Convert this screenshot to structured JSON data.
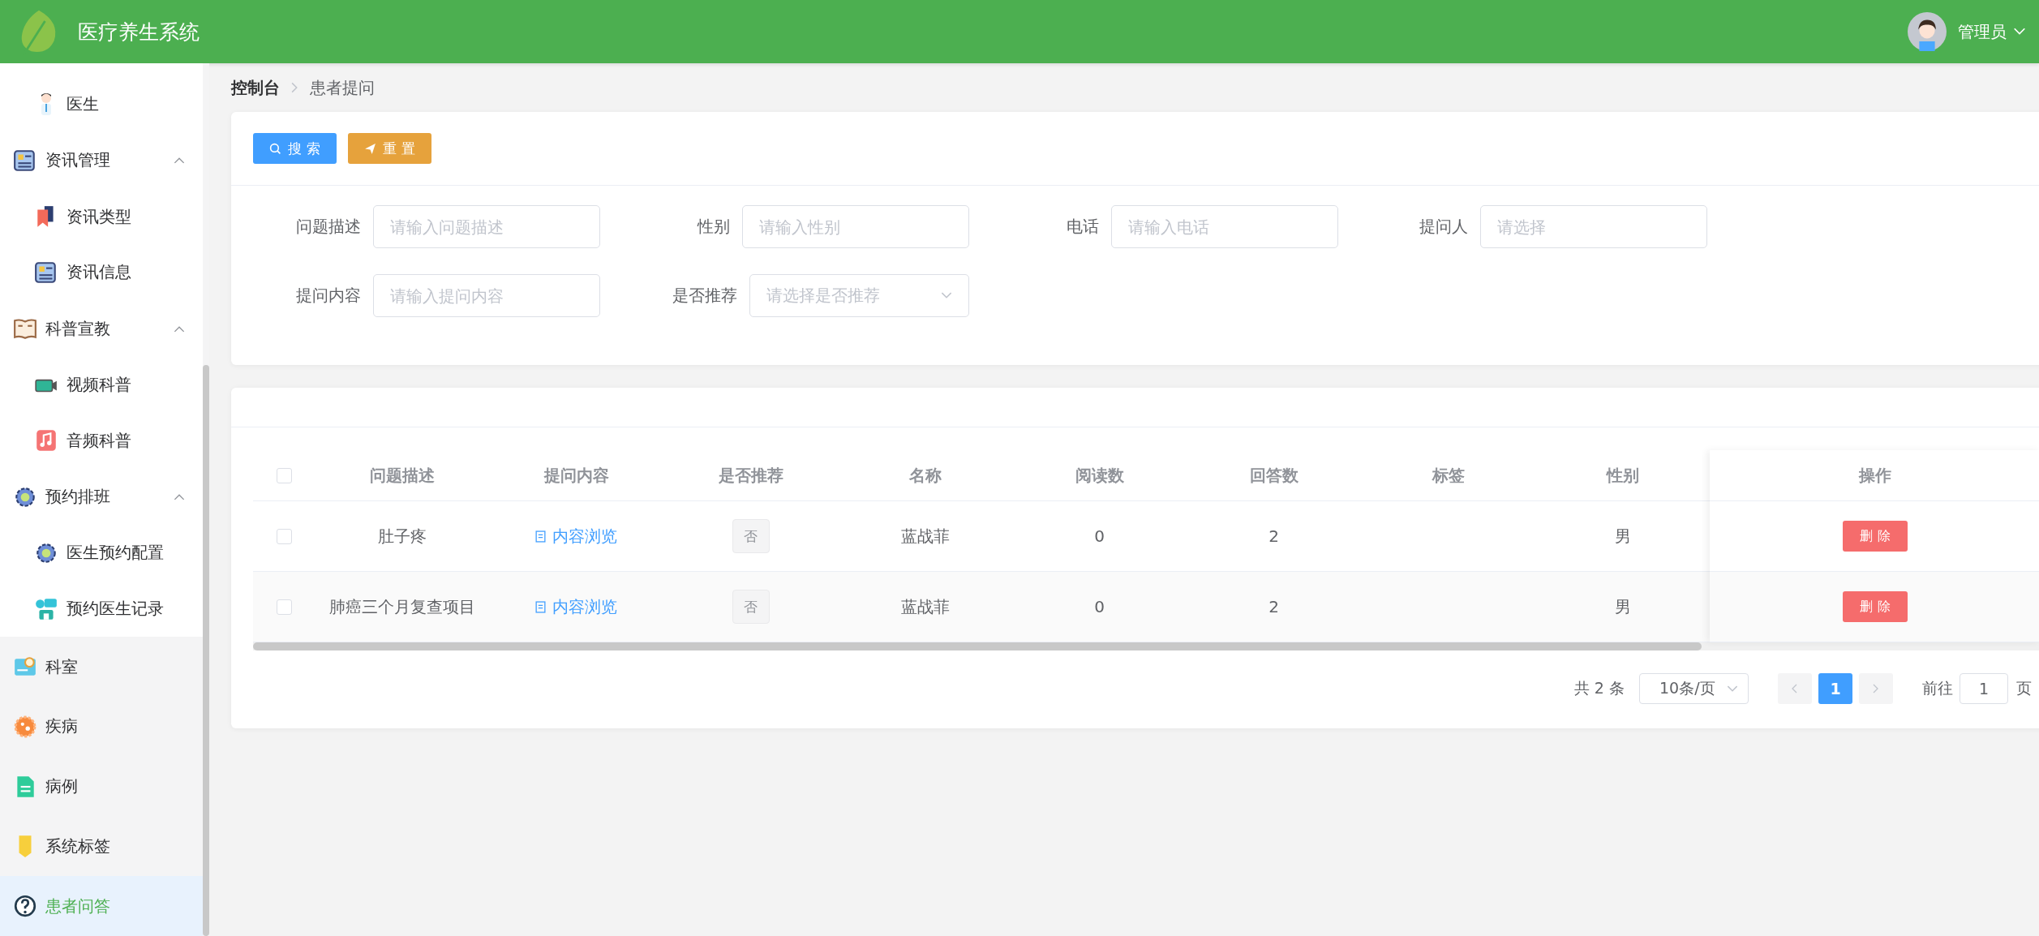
{
  "header": {
    "title": "医疗养生系统",
    "user": "管理员"
  },
  "sidebar": {
    "continued_children": [
      {
        "label": "医生",
        "selected": false
      }
    ],
    "items": [
      {
        "label": "资讯管理",
        "expanded": true,
        "selected": false,
        "children": [
          {
            "label": "资讯类型",
            "selected": false
          },
          {
            "label": "资讯信息",
            "selected": false
          }
        ]
      },
      {
        "label": "科普宣教",
        "expanded": true,
        "selected": false,
        "children": [
          {
            "label": "视频科普",
            "selected": false
          },
          {
            "label": "音频科普",
            "selected": false
          }
        ]
      },
      {
        "label": "预约排班",
        "expanded": true,
        "selected": false,
        "children": [
          {
            "label": "医生预约配置",
            "selected": false
          },
          {
            "label": "预约医生记录",
            "selected": false
          }
        ]
      },
      {
        "label": "科室",
        "selected": false
      },
      {
        "label": "疾病",
        "selected": false
      },
      {
        "label": "病例",
        "selected": false
      },
      {
        "label": "系统标签",
        "selected": false
      },
      {
        "label": "患者问答",
        "selected": true
      }
    ]
  },
  "breadcrumb": [
    "控制台",
    "患者提问"
  ],
  "search_panel": {
    "buttons": [
      {
        "label": "搜 索",
        "kind": "search"
      },
      {
        "label": "重 置",
        "kind": "reset"
      }
    ],
    "fields": [
      {
        "label": "问题描述",
        "placeholder": "请输入问题描述",
        "kind": "input"
      },
      {
        "label": "性别",
        "placeholder": "请输入性别",
        "kind": "input"
      },
      {
        "label": "电话",
        "placeholder": "请输入电话",
        "kind": "input"
      },
      {
        "label": "提问人",
        "placeholder": "请选择",
        "kind": "input"
      },
      {
        "label": "提问内容",
        "placeholder": "请输入提问内容",
        "kind": "input"
      },
      {
        "label": "是否推荐",
        "placeholder": "请选择是否推荐",
        "kind": "select"
      }
    ]
  },
  "table": {
    "all_checked": false,
    "columns": [
      {
        "label": "问题描述",
        "kind": "text"
      },
      {
        "label": "提问内容",
        "kind": "link"
      },
      {
        "label": "是否推荐",
        "kind": "tag"
      },
      {
        "label": "名称",
        "kind": "text"
      },
      {
        "label": "阅读数",
        "kind": "text"
      },
      {
        "label": "回答数",
        "kind": "text"
      },
      {
        "label": "标签"
      },
      {
        "label": "性别",
        "kind": "text"
      }
    ],
    "action_column": "操作",
    "rows": [
      {
        "checked": false,
        "cells": [
          "肚子疼",
          "内容浏览",
          "否",
          "蓝战菲",
          "0",
          "2",
          null,
          "男"
        ],
        "action": "删 除"
      },
      {
        "checked": false,
        "cells": [
          "肺癌三个月复查项目",
          "内容浏览",
          "否",
          "蓝战菲",
          "0",
          "2",
          null,
          "男"
        ],
        "action": "删 除"
      }
    ]
  },
  "pagination": {
    "total": "共 2 条",
    "page_size": "10条/页",
    "pages": [
      {
        "label": "1",
        "selected": true
      }
    ],
    "prev_disabled": true,
    "next_disabled": true,
    "goto_label": "前往",
    "goto_value": "1",
    "goto_suffix": "页"
  }
}
